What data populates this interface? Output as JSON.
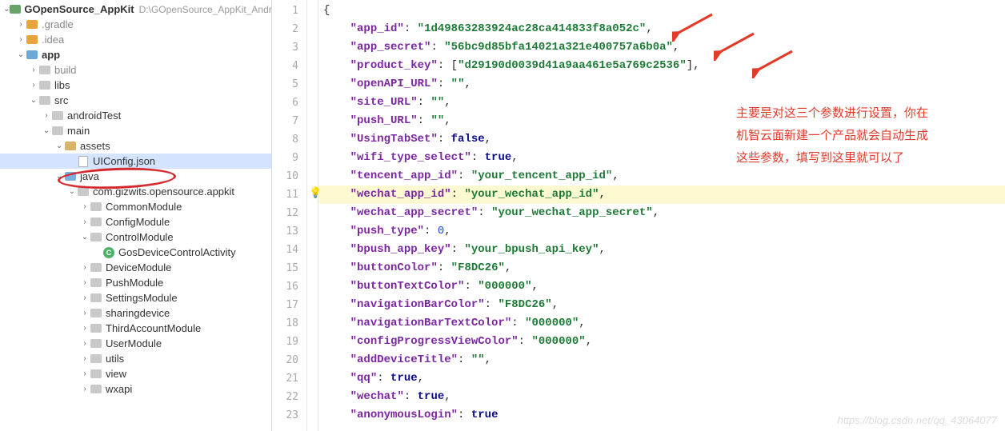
{
  "tree": {
    "root_name": "GOpenSource_AppKit",
    "root_path": "D:\\GOpenSource_AppKit_Andr...",
    "nodes": {
      "gradle": ".gradle",
      "idea": ".idea",
      "app": "app",
      "build": "build",
      "libs": "libs",
      "src": "src",
      "androidTest": "androidTest",
      "main": "main",
      "assets": "assets",
      "uiconfig": "UIConfig.json",
      "java": "java",
      "pkg": "com.gizwits.opensource.appkit",
      "common": "CommonModule",
      "config": "ConfigModule",
      "control": "ControlModule",
      "gosdev": "GosDeviceControlActivity",
      "device": "DeviceModule",
      "push": "PushModule",
      "settings": "SettingsModule",
      "sharing": "sharingdevice",
      "third": "ThirdAccountModule",
      "user": "UserModule",
      "utils": "utils",
      "view": "view",
      "wxapi": "wxapi"
    }
  },
  "code": {
    "values": {
      "app_id": "1d49863283924ac28ca414833f8a052c",
      "app_secret": "56bc9d85bfa14021a321e400757a6b0a",
      "product_key": "d29190d0039d41a9aa461e5a769c2536",
      "openAPI_URL": "",
      "site_URL": "",
      "push_URL": "",
      "UsingTabSet": "false",
      "wifi_type_select": "true",
      "tencent_app_id": "your_tencent_app_id",
      "wechat_app_id": "your_wechat_app_id",
      "wechat_app_secret": "your_wechat_app_secret",
      "push_type": "0",
      "bpush_app_key": "your_bpush_api_key",
      "buttonColor": "F8DC26",
      "buttonTextColor": "000000",
      "navigationBarColor": "F8DC26",
      "navigationBarTextColor": "000000",
      "configProgressViewColor": "000000",
      "addDeviceTitle": "",
      "qq": "true",
      "wechat": "true",
      "anonymousLogin": "true"
    },
    "keys": {
      "app_id": "app_id",
      "app_secret": "app_secret",
      "product_key": "product_key",
      "openAPI_URL": "openAPI_URL",
      "site_URL": "site_URL",
      "push_URL": "push_URL",
      "UsingTabSet": "UsingTabSet",
      "wifi_type_select": "wifi_type_select",
      "tencent_app_id": "tencent_app_id",
      "wechat_app_id": "wechat_app_id",
      "wechat_app_secret": "wechat_app_secret",
      "push_type": "push_type",
      "bpush_app_key": "bpush_app_key",
      "buttonColor": "buttonColor",
      "buttonTextColor": "buttonTextColor",
      "navigationBarColor": "navigationBarColor",
      "navigationBarTextColor": "navigationBarTextColor",
      "configProgressViewColor": "configProgressViewColor",
      "addDeviceTitle": "addDeviceTitle",
      "qq": "qq",
      "wechat": "wechat",
      "anonymousLogin": "anonymousLogin"
    }
  },
  "annotation": {
    "line1": "主要是对这三个参数进行设置，你在",
    "line2": "机智云面新建一个产品就会自动生成",
    "line3": "这些参数，填写到这里就可以了"
  },
  "watermark": "https://blog.csdn.net/qq_43064077",
  "line_numbers": [
    "1",
    "2",
    "3",
    "4",
    "5",
    "6",
    "7",
    "8",
    "9",
    "10",
    "11",
    "12",
    "13",
    "14",
    "15",
    "16",
    "17",
    "18",
    "19",
    "20",
    "21",
    "22",
    "23"
  ]
}
